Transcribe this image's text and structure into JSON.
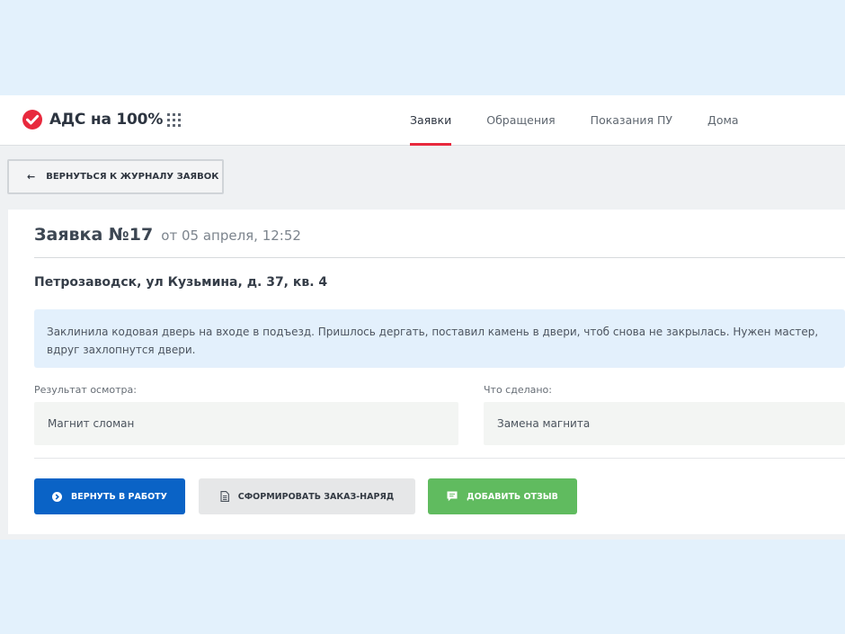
{
  "header": {
    "app_title": "АДС на 100%",
    "tabs": [
      {
        "label": "Заявки",
        "active": true
      },
      {
        "label": "Обращения",
        "active": false
      },
      {
        "label": "Показания ПУ",
        "active": false
      },
      {
        "label": "Дома",
        "active": false
      }
    ]
  },
  "back_button": {
    "label": "ВЕРНУТЬСЯ К ЖУРНАЛУ ЗАЯВОК"
  },
  "request": {
    "title": "Заявка №17",
    "date": "от 05 апреля, 12:52",
    "address": "Петрозаводск, ул Кузьмина, д. 37, кв. 4",
    "description": "Заклинила кодовая дверь на входе в подъезд. Пришлось дергать, поставил камень в двери, чтоб снова не закрылась. Нужен мастер, вдруг захлопнутся двери.",
    "inspection_label": "Результат осмотра:",
    "inspection_value": "Магнит сломан",
    "done_label": "Что сделано:",
    "done_value": "Замена магнита"
  },
  "actions": {
    "return_label": "ВЕРНУТЬ В РАБОТУ",
    "order_label": "СФОРМИРОВАТЬ ЗАКАЗ-НАРЯД",
    "review_label": "ДОБАВИТЬ ОТЗЫВ"
  },
  "colors": {
    "accent_red": "#e8293d",
    "primary_blue": "#0a63c6",
    "success_green": "#60bb5f"
  },
  "icons": {
    "logo": "check-circle-icon",
    "apps": "apps-grid-icon",
    "back": "arrow-left-icon",
    "return": "arrow-circle-right-icon",
    "order": "document-icon",
    "review": "comment-icon"
  }
}
